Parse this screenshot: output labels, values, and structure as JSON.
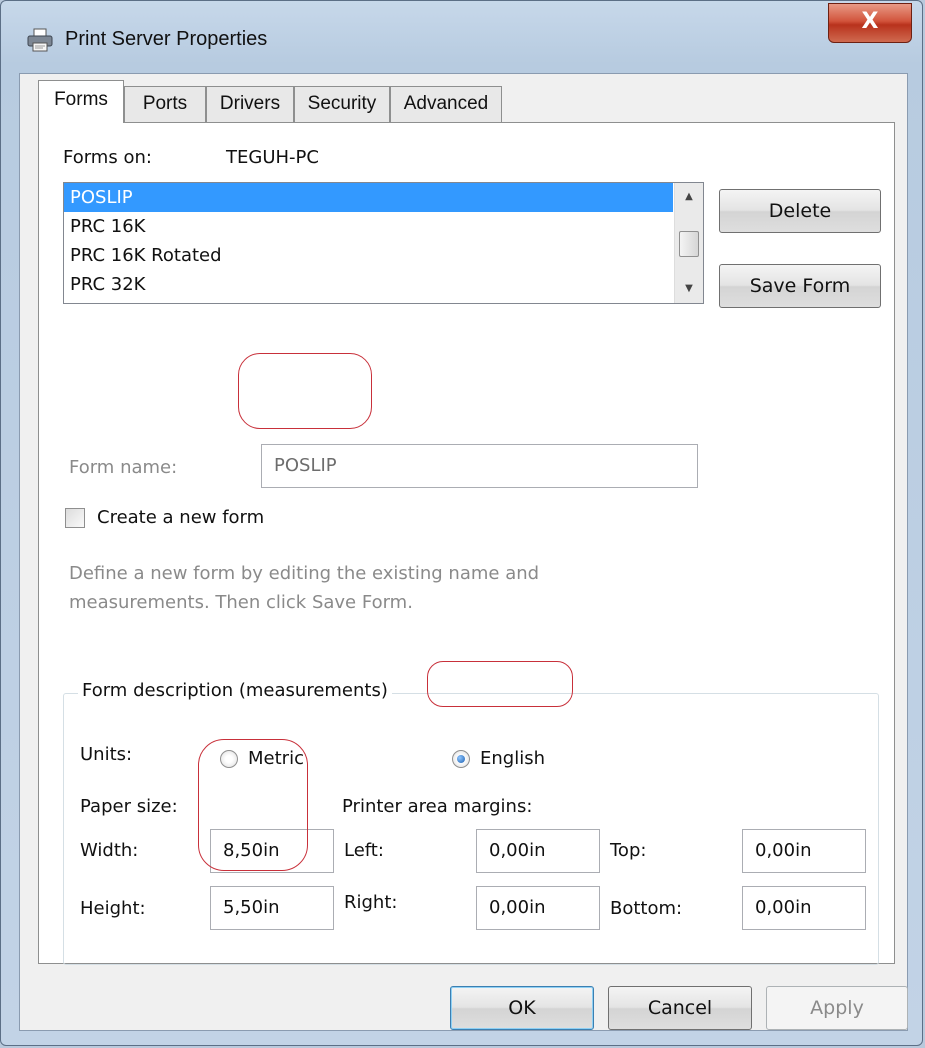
{
  "window": {
    "title": "Print Server Properties",
    "close_glyph": "X",
    "title_icon": "printer-icon"
  },
  "tabs": [
    {
      "label": "Forms",
      "active": true
    },
    {
      "label": "Ports",
      "active": false
    },
    {
      "label": "Drivers",
      "active": false
    },
    {
      "label": "Security",
      "active": false
    },
    {
      "label": "Advanced",
      "active": false
    }
  ],
  "forms": {
    "forms_on_label": "Forms on:",
    "computer_name": "TEGUH-PC",
    "list_items": [
      "POSLIP",
      "PRC 16K",
      "PRC 16K Rotated",
      "PRC 32K"
    ],
    "selected_item": "POSLIP",
    "delete_label": "Delete",
    "save_form_label": "Save Form",
    "form_name_label": "Form name:",
    "form_name_value": "POSLIP",
    "create_new_form_label": "Create a new form",
    "create_new_form_checked": false,
    "description_line1": "Define a new form by editing the existing name and",
    "description_line2": "measurements. Then click Save Form."
  },
  "measurements": {
    "group_title": "Form description (measurements)",
    "units_label": "Units:",
    "metric_label": "Metric",
    "english_label": "English",
    "selected_unit": "English",
    "paper_size_label": "Paper size:",
    "printer_margins_label": "Printer area margins:",
    "width_label": "Width:",
    "width_value": "8,50in",
    "height_label": "Height:",
    "height_value": "5,50in",
    "left_label": "Left:",
    "left_value": "0,00in",
    "right_label": "Right:",
    "right_value": "0,00in",
    "top_label": "Top:",
    "top_value": "0,00in",
    "bottom_label": "Bottom:",
    "bottom_value": "0,00in"
  },
  "dialog_buttons": {
    "ok_label": "OK",
    "cancel_label": "Cancel",
    "apply_label": "Apply",
    "apply_enabled": false
  },
  "colors": {
    "selection": "#3399ff",
    "annotation": "#c8303a",
    "close_button": "#c9442e"
  }
}
